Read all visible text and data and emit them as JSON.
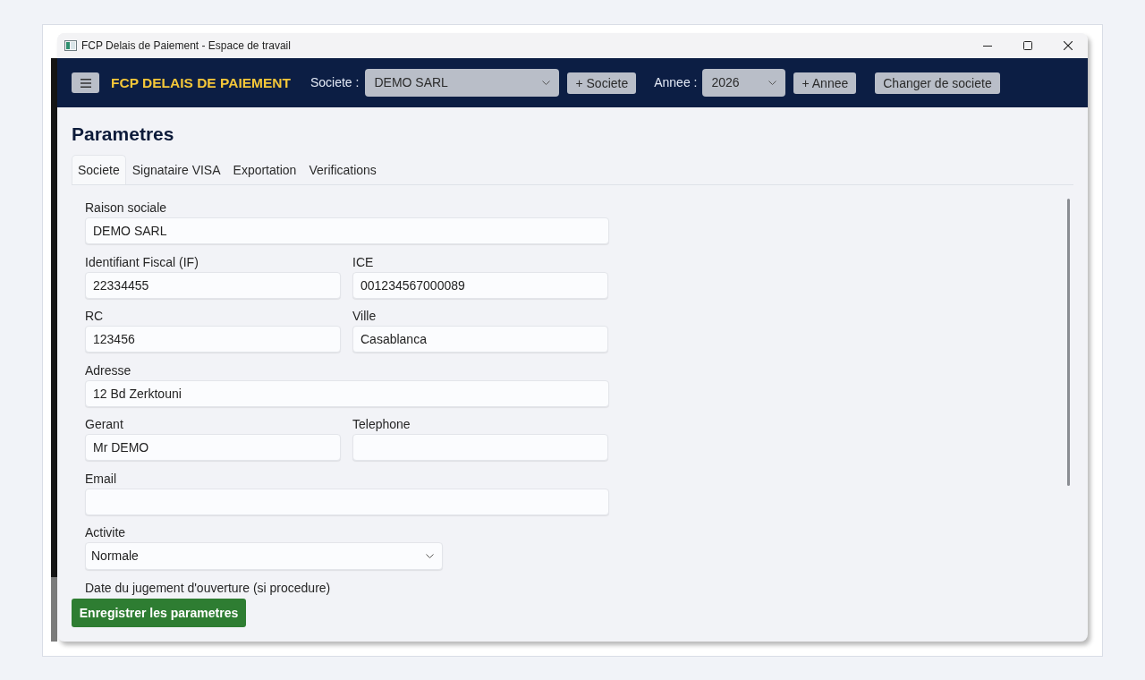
{
  "window": {
    "title": "FCP Delais de Paiement - Espace de travail"
  },
  "header": {
    "app_title": "FCP DELAIS DE PAIEMENT",
    "company_label": "Societe :",
    "company_select": "DEMO SARL",
    "add_company_button": "+ Societe",
    "year_label": "Annee :",
    "year_select": "2026",
    "add_year_button": "+ Annee",
    "change_company_button": "Changer de societe"
  },
  "page_title": "Parametres",
  "tabs": [
    {
      "label": "Societe",
      "selected": true
    },
    {
      "label": "Signataire VISA",
      "selected": false
    },
    {
      "label": "Exportation",
      "selected": false
    },
    {
      "label": "Verifications",
      "selected": false
    }
  ],
  "form": {
    "rows": [
      {
        "fields": [
          {
            "label": "Raison sociale",
            "kind": "text",
            "value": "DEMO SARL"
          }
        ]
      },
      {
        "fields": [
          {
            "label": "Identifiant Fiscal (IF)",
            "kind": "text",
            "value": "22334455"
          },
          {
            "label": "ICE",
            "kind": "text",
            "value": "001234567000089"
          }
        ]
      },
      {
        "fields": [
          {
            "label": "RC",
            "kind": "text",
            "value": "123456"
          },
          {
            "label": "Ville",
            "kind": "text",
            "value": "Casablanca"
          }
        ]
      },
      {
        "fields": [
          {
            "label": "Adresse",
            "kind": "text",
            "value": "12 Bd Zerktouni"
          }
        ]
      },
      {
        "fields": [
          {
            "label": "Gerant",
            "kind": "text",
            "value": "Mr DEMO"
          },
          {
            "label": "Telephone",
            "kind": "text"
          }
        ]
      },
      {
        "fields": [
          {
            "label": "Email",
            "kind": "text"
          }
        ]
      },
      {
        "fields": [
          {
            "label": "Activite",
            "kind": "select",
            "value": "Normale"
          }
        ]
      }
    ],
    "next_label": "Date du jugement d'ouverture (si procedure)"
  },
  "save_button": "Enregistrer les parametres"
}
